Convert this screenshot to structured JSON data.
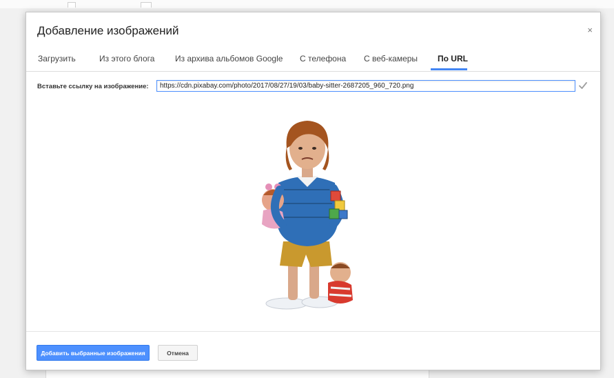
{
  "dialog": {
    "title": "Добавление изображений",
    "close_label": "×"
  },
  "tabs": [
    {
      "label": "Загрузить"
    },
    {
      "label": "Из этого блога"
    },
    {
      "label": "Из архива альбомов Google"
    },
    {
      "label": "С телефона"
    },
    {
      "label": "С веб-камеры"
    },
    {
      "label": "По URL",
      "active": true
    }
  ],
  "url_form": {
    "label": "Вставьте ссылку на изображение:",
    "value": "https://cdn.pixabay.com/photo/2017/08/27/19/03/baby-sitter-2687205_960_720.png"
  },
  "footer": {
    "add_label": "Добавить выбранные изображения",
    "cancel_label": "Отмена"
  },
  "colors": {
    "accent": "#4d90fe",
    "tab_underline": "#4285f4",
    "check_icon": "#9e9e9e"
  }
}
